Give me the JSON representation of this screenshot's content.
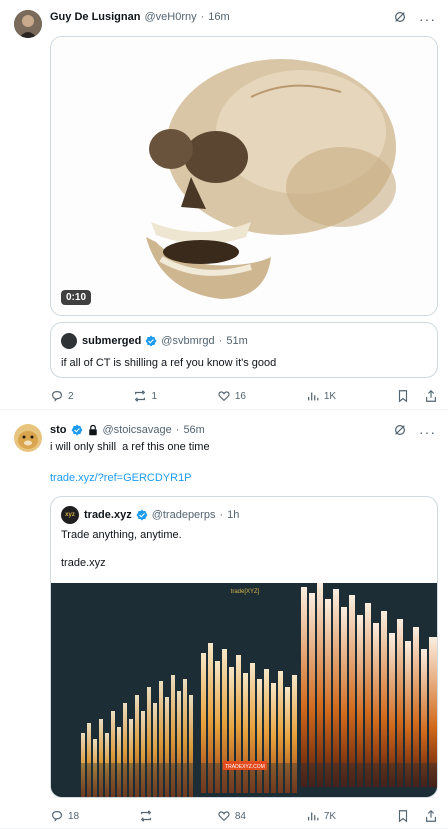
{
  "tweet1": {
    "author_name": "Guy De Lusignan",
    "author_handle": "@veH0rny",
    "time": "16m",
    "video_duration": "0:10",
    "quote": {
      "author_name": "submerged",
      "author_handle": "@svbmrgd",
      "time": "51m",
      "text": "if all of CT is shilling a ref you know it's good"
    },
    "actions": {
      "replies": "2",
      "reposts": "1",
      "likes": "16",
      "views": "1K"
    }
  },
  "tweet2": {
    "author_name": "sto",
    "author_handle": "@stoicsavage",
    "time": "56m",
    "text": "i will only shill  a ref this one time",
    "link": "trade.xyz/?ref=GERCDYR1P",
    "quote": {
      "author_name": "trade.xyz",
      "author_handle": "@tradeperps",
      "time": "1h",
      "text": "Trade anything, anytime.",
      "link_text": "trade.xyz",
      "image_brand": "trade[XYZ]",
      "image_button": "TRADEXYZ.COM"
    },
    "actions": {
      "replies": "18",
      "reposts": "",
      "likes": "84",
      "views": "7K"
    }
  },
  "colors": {
    "accent": "#1d9bf0",
    "muted": "#536471",
    "border": "#cfd9de"
  },
  "icons": [
    "grok-icon",
    "more-icon",
    "reply-icon",
    "repost-icon",
    "like-icon",
    "views-icon",
    "bookmark-icon",
    "share-icon",
    "verified-icon",
    "lock-icon"
  ]
}
